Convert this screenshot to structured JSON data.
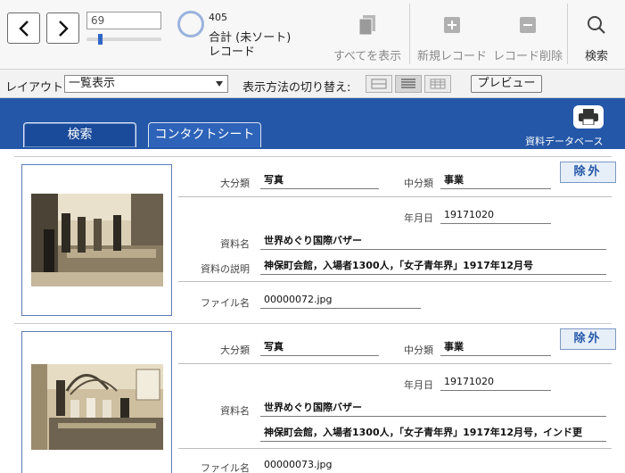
{
  "toolbar": {
    "record_number": "69",
    "record_count": "405",
    "total_label": "合計 (未ソート)",
    "unit_label": "レコード",
    "slider_fraction": 0.17,
    "show_all_label": "すべてを表示",
    "new_record_label": "新規レコード",
    "delete_record_label": "レコード削除",
    "search_label": "検索"
  },
  "layoutbar": {
    "layout_label": "レイアウト:",
    "layout_value": "一覧表示",
    "view_switch_label": "表示方法の切り替え:",
    "preview_label": "プレビュー"
  },
  "header": {
    "tabs": [
      {
        "label": "検索"
      },
      {
        "label": "コンタクトシート"
      }
    ],
    "title": "資料データベース"
  },
  "labels": {
    "category_major": "大分類",
    "category_minor": "中分類",
    "date": "年月日",
    "name": "資料名",
    "description": "資料の説明",
    "filename": "ファイル名",
    "exclude": "除外"
  },
  "records": [
    {
      "category_major": "写真",
      "category_minor": "事業",
      "date": "19171020",
      "name": "世界めぐり国際バザー",
      "description": "神保町会館，入場者1300人，「女子青年界」1917年12月号",
      "filename": "00000072.jpg"
    },
    {
      "category_major": "写真",
      "category_minor": "事業",
      "date": "19171020",
      "name": "世界めぐり国際バザー",
      "description": "神保町会館，入場者1300人，「女子青年界」1917年12月号，インド更",
      "filename": "00000073.jpg"
    }
  ],
  "colors": {
    "header_blue": "#2457a8",
    "accent_blue": "#2f66c8"
  }
}
